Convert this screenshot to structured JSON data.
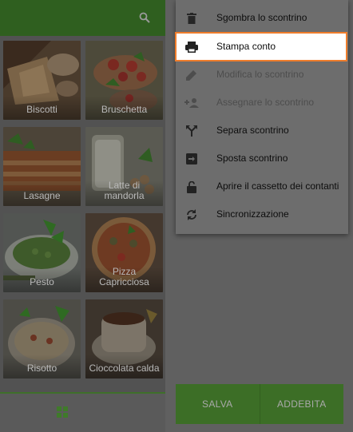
{
  "topbar": {
    "search_icon": "search-icon"
  },
  "tiles": [
    {
      "label": "Biscotti",
      "icon": "biscotti-photo"
    },
    {
      "label": "Bruschetta",
      "icon": "bruschetta-photo"
    },
    {
      "label": "Lasagne",
      "icon": "lasagne-photo"
    },
    {
      "label": "Latte di mandorla",
      "icon": "latte-photo"
    },
    {
      "label": "Pesto",
      "icon": "pesto-photo"
    },
    {
      "label": "Pizza Capricciosa",
      "icon": "pizza-photo"
    },
    {
      "label": "Risotto",
      "icon": "risotto-photo"
    },
    {
      "label": "Cioccolata calda",
      "icon": "cioccolata-photo"
    }
  ],
  "bottom_nav": {
    "icon": "grid-icon"
  },
  "menu": {
    "items": [
      {
        "label": "Sgombra lo scontrino",
        "icon": "trash-icon",
        "enabled": true
      },
      {
        "label": "Stampa conto",
        "icon": "printer-icon",
        "enabled": true,
        "highlighted": true
      },
      {
        "label": "Modifica lo scontrino",
        "icon": "pencil-icon",
        "enabled": false
      },
      {
        "label": "Assegnare lo scontrino",
        "icon": "assign-user-icon",
        "enabled": false
      },
      {
        "label": "Separa scontrino",
        "icon": "split-icon",
        "enabled": true
      },
      {
        "label": "Sposta scontrino",
        "icon": "move-icon",
        "enabled": true
      },
      {
        "label": "Aprire il cassetto dei contanti",
        "icon": "unlock-icon",
        "enabled": true
      },
      {
        "label": "Sincronizzazione",
        "icon": "sync-icon",
        "enabled": true
      }
    ]
  },
  "actions": {
    "save_label": "SALVA",
    "charge_label": "ADDEBITA"
  },
  "colors": {
    "accent_green": "#4caf50",
    "highlight_border": "#f57c28"
  }
}
